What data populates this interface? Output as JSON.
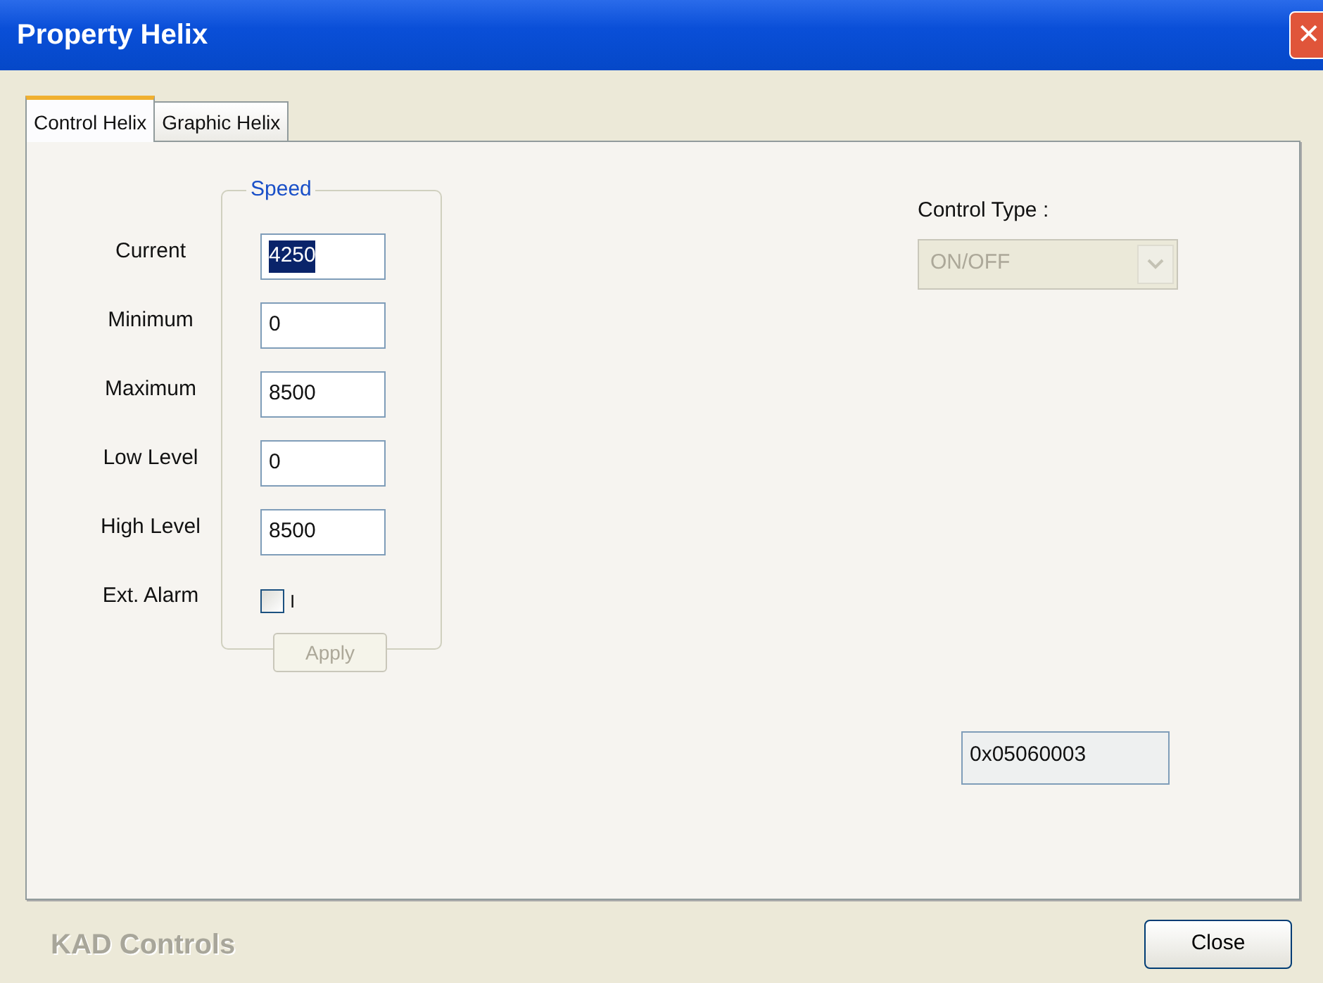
{
  "window": {
    "title": "Property Helix",
    "close_glyph": "✕"
  },
  "tabs": [
    {
      "label": "Control Helix",
      "selected": true
    },
    {
      "label": "Graphic Helix",
      "selected": false
    }
  ],
  "speed_group": {
    "title": "Speed",
    "fields": [
      {
        "kind": "text",
        "label": "Current",
        "value": "4250",
        "text_selected": true
      },
      {
        "kind": "text",
        "label": "Minimum",
        "value": "0",
        "text_selected": false
      },
      {
        "kind": "text",
        "label": "Maximum",
        "value": "8500",
        "text_selected": false
      },
      {
        "kind": "text",
        "label": "Low Level",
        "value": "0",
        "text_selected": false
      },
      {
        "kind": "text",
        "label": "High Level",
        "value": "8500",
        "text_selected": false
      },
      {
        "kind": "checkbox",
        "label": "Ext. Alarm",
        "checked": false,
        "caption": "I"
      }
    ],
    "apply_button": {
      "label": "Apply",
      "disabled": true
    }
  },
  "control_type": {
    "label": "Control Type :",
    "value": "ON/OFF",
    "disabled": true
  },
  "address_field": {
    "value": "0x05060003"
  },
  "footer": {
    "brand": "KAD Controls",
    "close_button": "Close"
  }
}
